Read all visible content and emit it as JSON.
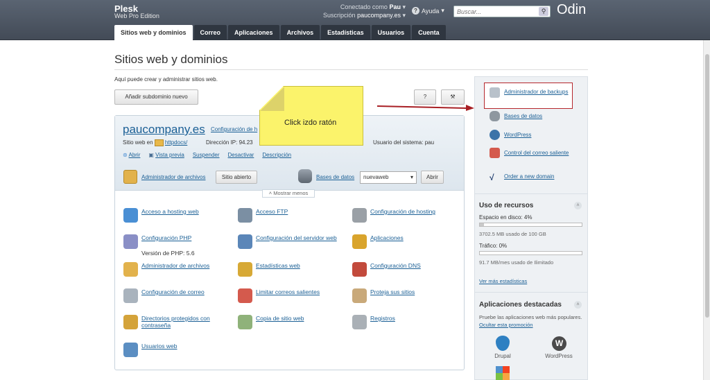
{
  "header": {
    "brand": "Plesk",
    "edition": "Web Pro Edition",
    "connected_label": "Conectado como",
    "user": "Pau",
    "subscription_label": "Suscripción",
    "subscription": "paucompany.es",
    "help": "Ayuda",
    "search_placeholder": "Buscar...",
    "odin": "Odin"
  },
  "tabs": [
    "Sitios web y dominios",
    "Correo",
    "Aplicaciones",
    "Archivos",
    "Estadísticas",
    "Usuarios",
    "Cuenta"
  ],
  "page": {
    "title": "Sitios web y dominios",
    "intro": "Aquí puede crear y administrar sitios web.",
    "add_subdomain": "Añadir subdominio nuevo",
    "help_btn": "?",
    "tool_btn": "⚒"
  },
  "note": "Click izdo ratón",
  "domain": {
    "name": "paucompany.es",
    "config_link": "Configuración de h",
    "site_label": "Sitio web en",
    "docroot": "httpdocs/",
    "ip_label": "Dirección IP: 94.23",
    "sysuser": "Usuario del sistema: pau",
    "actions": [
      "Abrir",
      "Vista previa",
      "Suspender",
      "Desactivar",
      "Descripción"
    ],
    "file_manager": "Administrador de archivos",
    "site_open": "Sitio abierto",
    "db_link": "Bases de datos",
    "db_value": "nuevaweb",
    "db_open": "Abrir",
    "show_less": "Mostrar menos"
  },
  "tools": [
    {
      "label": "Acceso a hosting web",
      "sub": "",
      "color": "#4a8fd4"
    },
    {
      "label": "Acceso FTP",
      "sub": "",
      "color": "#7b8fa3"
    },
    {
      "label": "Configuración de hosting",
      "sub": "",
      "color": "#9aa0a6"
    },
    {
      "label": "Configuración PHP",
      "sub": "Versión de PHP: 5.6",
      "color": "#8a8fc6"
    },
    {
      "label": "Configuración del servidor web",
      "sub": "",
      "color": "#5b86b8"
    },
    {
      "label": "Aplicaciones",
      "sub": "",
      "color": "#d9a42c"
    },
    {
      "label": "Administrador de archivos",
      "sub": "",
      "color": "#e2b24c"
    },
    {
      "label": "Estadísticas web",
      "sub": "",
      "color": "#d7a936"
    },
    {
      "label": "Configuración DNS",
      "sub": "",
      "color": "#c24a3c"
    },
    {
      "label": "Configuración de correo",
      "sub": "",
      "color": "#a9b3bd"
    },
    {
      "label": "Limitar correos salientes",
      "sub": "",
      "color": "#d45a4d"
    },
    {
      "label": "Proteja sus sitios",
      "sub": "",
      "color": "#c9a97a"
    },
    {
      "label": "Directorios protegidos con contraseña",
      "sub": "",
      "color": "#d4a33a"
    },
    {
      "label": "Copia de sitio web",
      "sub": "",
      "color": "#8fb27a"
    },
    {
      "label": "Registros",
      "sub": "",
      "color": "#aab0b6"
    },
    {
      "label": "Usuarios web",
      "sub": "",
      "color": "#5b8ec2"
    }
  ],
  "sidebar": {
    "links": [
      "Administrador de backups",
      "Bases de datos",
      "WordPress",
      "Control del correo saliente",
      "Order a new domain"
    ],
    "resources_title": "Uso de recursos",
    "disk_label": "Espacio en disco: 4%",
    "disk_usage": "3702.5 MB usado de 100 GB",
    "disk_percent": 4,
    "traffic_label": "Tráfico: 0%",
    "traffic_usage": "91.7 MB/mes usado de Ilimitado",
    "traffic_percent": 0,
    "more_stats": "Ver más estadísticas",
    "apps_title": "Aplicaciones destacadas",
    "apps_intro": "Pruebe las aplicaciones web más populares.",
    "apps_hide": "Ocultar esta promoción",
    "apps": [
      "Drupal",
      "WordPress"
    ]
  }
}
